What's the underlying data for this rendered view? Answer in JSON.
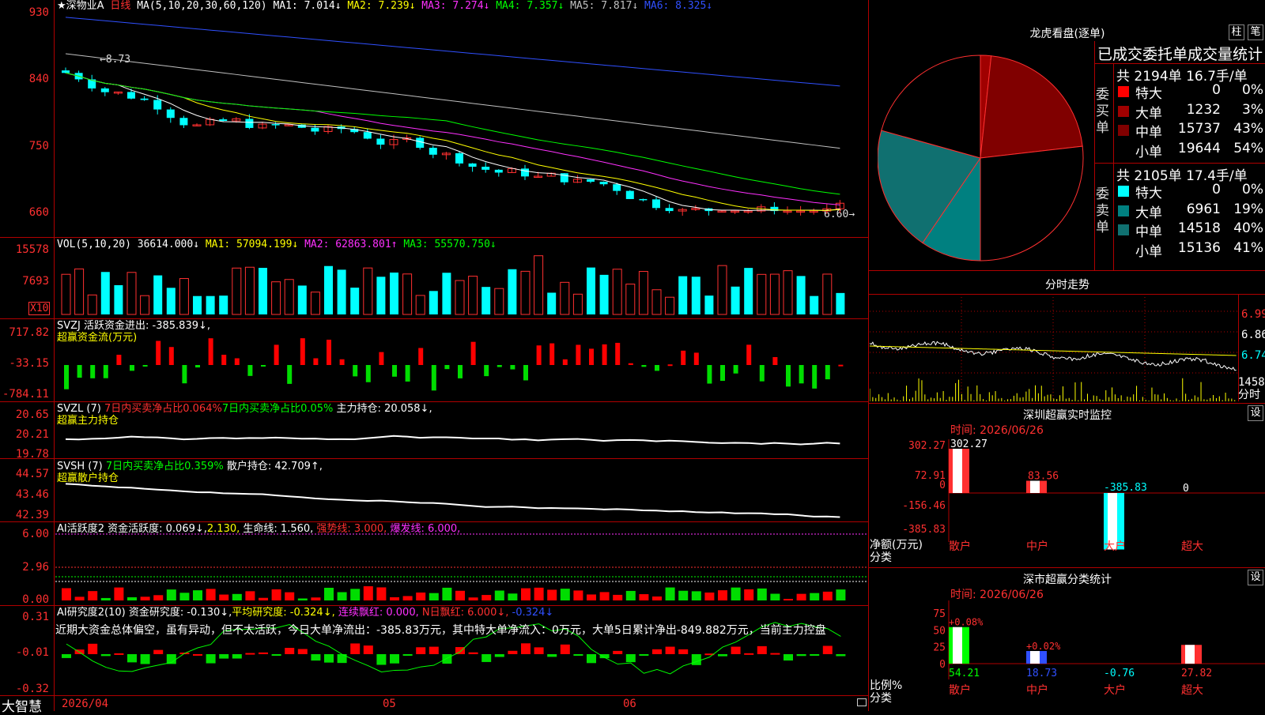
{
  "app": {
    "brand": "大智慧"
  },
  "main_chart": {
    "stock_name": "★深物业A",
    "period": "日线",
    "ma_header": "MA(5,10,20,30,60,120)",
    "ma_values": [
      {
        "label": "MA1: 7.014↓",
        "color": "#ffffff"
      },
      {
        "label": "MA2: 7.239↓",
        "color": "#ffff00"
      },
      {
        "label": "MA3: 7.274↓",
        "color": "#ff30ff"
      },
      {
        "label": "MA4: 7.357↓",
        "color": "#00ff00"
      },
      {
        "label": "MA5: 7.817↓",
        "color": "#c0c0c0"
      },
      {
        "label": "MA6: 8.325↓",
        "color": "#3050ff"
      }
    ],
    "y_ticks": [
      "930",
      "840",
      "750",
      "660"
    ],
    "high_marker": "8.73",
    "low_marker": "6.60"
  },
  "volume": {
    "header": "VOL(5,10,20)",
    "value": "36614.000↓",
    "ma1": "MA1: 57094.199↓",
    "ma2": "MA2: 62863.801↑",
    "ma3": "MA3: 55570.750↓",
    "y_ticks": [
      "15578",
      "7693"
    ],
    "unit": "X10"
  },
  "svzj": {
    "header": "SVZJ",
    "line1": "活跃资金进出: -385.839↓,",
    "line2": "超赢资金流(万元)",
    "y_ticks": [
      "717.82",
      "-33.15",
      "-784.11"
    ]
  },
  "svzl": {
    "header": "SVZL (7)",
    "part1": "7日内买卖净占比0.064%",
    "part2": "7日内买卖净占比0.05%",
    "part3": "主力持仓: 20.058↓,",
    "line2": "超赢主力持仓",
    "y_ticks": [
      "20.65",
      "20.21",
      "19.78"
    ]
  },
  "svsh": {
    "header": "SVSH (7)",
    "part1": "7日内买卖净占比0.359%",
    "part2": "散户持仓: 42.709↑,",
    "line2": "超赢散户持仓",
    "y_ticks": [
      "44.57",
      "43.46",
      "42.39"
    ]
  },
  "ai_active": {
    "header": "AI活跃度2",
    "p1": "资金活跃度: 0.069↓,",
    "p2": "2.130,",
    "p3": "生命线: 1.560,",
    "p4": "强势线: 3.000,",
    "p5": "爆发线: 6.000,",
    "y_ticks": [
      "6.00",
      "2.96",
      "0.00"
    ]
  },
  "ai_research": {
    "header": "AI研究度2(10)",
    "p1": "资金研究度: -0.130↓,",
    "p2": "平均研究度: -0.324↓,",
    "p3": "连续飘红: 0.000,",
    "p4": "N日飘红: 6.000↓,",
    "p5": "-0.324↓",
    "commentary": "近期大资金总体偏空，虽有异动，但不太活跃，今日大单净流出：-385.83万元，其中特大单净流入：0万元，大单5日累计净出-849.882万元，当前主力控盘",
    "y_ticks": [
      "0.31",
      "-0.01",
      "-0.32"
    ]
  },
  "x_axis": {
    "labels": [
      "2026/04",
      "05",
      "06"
    ]
  },
  "lhb": {
    "title": "龙虎看盘(逐单)",
    "btn1": "柱",
    "btn2": "笔",
    "subtitle": "已成交委托单成交量统计",
    "buy_side_label": "委买单",
    "sell_side_label": "委卖单",
    "buy_summary": "共 2194单 16.7手/单",
    "sell_summary": "共 2105单 17.4手/单",
    "buy_rows": [
      {
        "name": "特大",
        "vol": "0",
        "pct": "0%",
        "color": "#ff0000"
      },
      {
        "name": "大单",
        "vol": "1232",
        "pct": "3%",
        "color": "#a00000"
      },
      {
        "name": "中单",
        "vol": "15737",
        "pct": "43%",
        "color": "#800000"
      },
      {
        "name": "小单",
        "vol": "19644",
        "pct": "54%",
        "color": "#000000"
      }
    ],
    "sell_rows": [
      {
        "name": "特大",
        "vol": "0",
        "pct": "0%",
        "color": "#00ffff"
      },
      {
        "name": "大单",
        "vol": "6961",
        "pct": "19%",
        "color": "#008080"
      },
      {
        "name": "中单",
        "vol": "14518",
        "pct": "40%",
        "color": "#107070"
      },
      {
        "name": "小单",
        "vol": "15136",
        "pct": "41%",
        "color": "#000000"
      }
    ]
  },
  "intraday": {
    "title": "分时走势",
    "y_ticks": [
      "6.99",
      "6.86",
      "6.74"
    ],
    "vol_tick": "1458",
    "vol_label": "分时"
  },
  "sz_monitor": {
    "title": "深圳超赢实时监控",
    "btn": "设",
    "time": "时间: 2026/06/26",
    "y_ticks": [
      "302.27",
      "72.91",
      "0",
      "-156.46",
      "-385.83"
    ],
    "y_unit_1": "净额(万元)",
    "y_unit_2": "分类",
    "bars": [
      {
        "cat": "散户",
        "value": 302.27,
        "label": "302.27",
        "color": "#ff3030",
        "label_color": "#ffffff"
      },
      {
        "cat": "中户",
        "value": 83.56,
        "label": "83.56",
        "color": "#ff3030",
        "label_color": "#ff3030"
      },
      {
        "cat": "大户",
        "value": -385.83,
        "label": "-385.83",
        "color": "#00ffff",
        "label_color": "#00ffff"
      },
      {
        "cat": "超大",
        "value": 0,
        "label": "0",
        "color": "#ffffff",
        "label_color": "#ffffff"
      }
    ]
  },
  "sz_class": {
    "title": "深市超赢分类统计",
    "btn": "设",
    "time": "时间: 2026/06/26",
    "y_ticks": [
      "75",
      "50",
      "25",
      "0"
    ],
    "y_unit_1": "比例%",
    "y_unit_2": "分类",
    "bars": [
      {
        "cat": "散户",
        "value": 54.21,
        "label": "54.21",
        "delta": "+0.08%",
        "color": "#00ff00",
        "cat_color": "#ff3030"
      },
      {
        "cat": "中户",
        "value": 18.73,
        "label": "18.73",
        "delta": "+0.02%",
        "color": "#3050ff",
        "cat_color": "#ff3030"
      },
      {
        "cat": "大户",
        "value": -0.76,
        "label": "-0.76",
        "delta": "",
        "color": "#00ffff",
        "cat_color": "#ff3030"
      },
      {
        "cat": "超大",
        "value": 27.82,
        "label": "27.82",
        "delta": "",
        "color": "#ff3030",
        "cat_color": "#ff3030"
      }
    ]
  }
}
